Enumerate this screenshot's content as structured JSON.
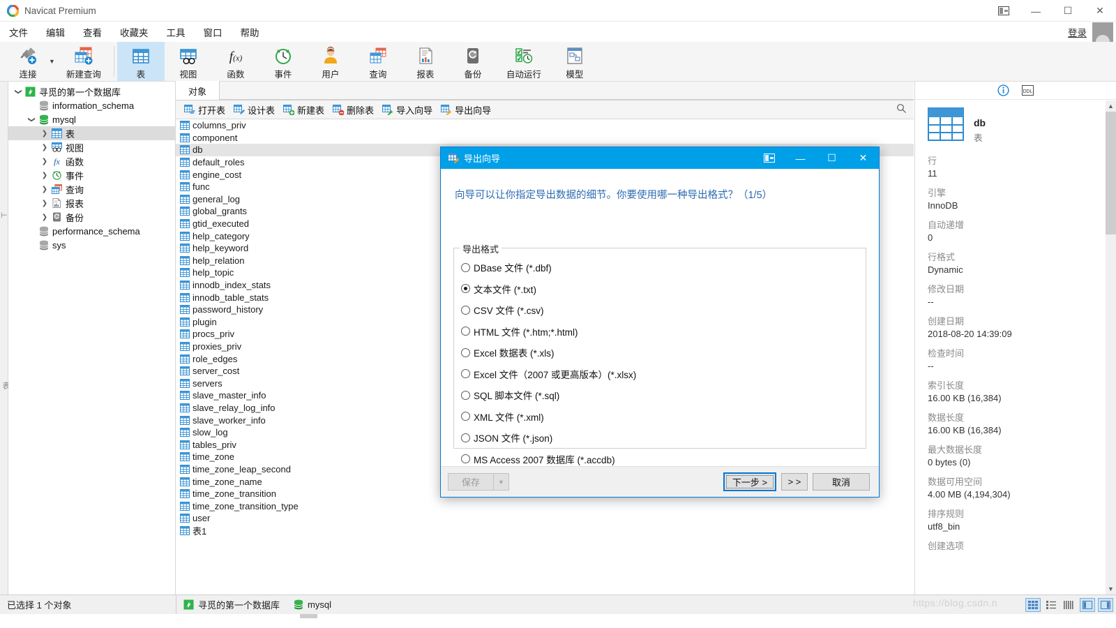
{
  "window": {
    "title": "Navicat Premium",
    "controls": {
      "panel": "panel-toggle",
      "minimize": "—",
      "maximize": "☐",
      "close": "✕"
    }
  },
  "menubar": {
    "items": [
      {
        "label": "文件",
        "name": "menu-file"
      },
      {
        "label": "编辑",
        "name": "menu-edit"
      },
      {
        "label": "查看",
        "name": "menu-view"
      },
      {
        "label": "收藏夹",
        "name": "menu-favorites"
      },
      {
        "label": "工具",
        "name": "menu-tools"
      },
      {
        "label": "窗口",
        "name": "menu-window"
      },
      {
        "label": "帮助",
        "name": "menu-help"
      }
    ],
    "login_label": "登录"
  },
  "ribbon": {
    "items": [
      {
        "label": "连接",
        "icon": "connection-icon",
        "active": false
      },
      {
        "label": "新建查询",
        "icon": "new-query-icon",
        "active": false
      },
      {
        "label": "表",
        "icon": "table-icon",
        "active": true
      },
      {
        "label": "视图",
        "icon": "view-icon",
        "active": false
      },
      {
        "label": "函数",
        "icon": "function-icon",
        "active": false
      },
      {
        "label": "事件",
        "icon": "event-icon",
        "active": false
      },
      {
        "label": "用户",
        "icon": "user-icon",
        "active": false
      },
      {
        "label": "查询",
        "icon": "query-icon",
        "active": false
      },
      {
        "label": "报表",
        "icon": "report-icon",
        "active": false
      },
      {
        "label": "备份",
        "icon": "backup-icon",
        "active": false
      },
      {
        "label": "自动运行",
        "icon": "automation-icon",
        "active": false
      },
      {
        "label": "模型",
        "icon": "model-icon",
        "active": false
      }
    ]
  },
  "tree": {
    "nodes": [
      {
        "label": "寻觅的第一个数据库",
        "indent": 0,
        "twisty": "down",
        "icon": "navicat-connection-icon",
        "selected": false
      },
      {
        "label": "information_schema",
        "indent": 1,
        "twisty": "",
        "icon": "database-icon",
        "selected": false
      },
      {
        "label": "mysql",
        "indent": 1,
        "twisty": "down",
        "icon": "database-open-icon",
        "selected": false
      },
      {
        "label": "表",
        "indent": 2,
        "twisty": "right",
        "icon": "table-icon",
        "selected": true
      },
      {
        "label": "视图",
        "indent": 2,
        "twisty": "right",
        "icon": "view-icon",
        "selected": false
      },
      {
        "label": "函数",
        "indent": 2,
        "twisty": "right",
        "icon": "function-icon",
        "selected": false
      },
      {
        "label": "事件",
        "indent": 2,
        "twisty": "right",
        "icon": "event-icon",
        "selected": false
      },
      {
        "label": "查询",
        "indent": 2,
        "twisty": "right",
        "icon": "query-icon",
        "selected": false
      },
      {
        "label": "报表",
        "indent": 2,
        "twisty": "right",
        "icon": "report-icon",
        "selected": false
      },
      {
        "label": "备份",
        "indent": 2,
        "twisty": "right",
        "icon": "backup-icon",
        "selected": false
      },
      {
        "label": "performance_schema",
        "indent": 1,
        "twisty": "",
        "icon": "database-icon",
        "selected": false
      },
      {
        "label": "sys",
        "indent": 1,
        "twisty": "",
        "icon": "database-icon",
        "selected": false
      }
    ]
  },
  "center": {
    "tab_label": "对象",
    "object_toolbar": [
      {
        "label": "打开表",
        "icon": "open-table-icon"
      },
      {
        "label": "设计表",
        "icon": "design-table-icon"
      },
      {
        "label": "新建表",
        "icon": "new-table-icon"
      },
      {
        "label": "删除表",
        "icon": "delete-table-icon"
      },
      {
        "label": "导入向导",
        "icon": "import-wizard-icon"
      },
      {
        "label": "导出向导",
        "icon": "export-wizard-icon"
      }
    ],
    "tables": [
      {
        "name": "columns_priv",
        "selected": false
      },
      {
        "name": "component",
        "selected": false
      },
      {
        "name": "db",
        "selected": true
      },
      {
        "name": "default_roles",
        "selected": false
      },
      {
        "name": "engine_cost",
        "selected": false
      },
      {
        "name": "func",
        "selected": false
      },
      {
        "name": "general_log",
        "selected": false
      },
      {
        "name": "global_grants",
        "selected": false
      },
      {
        "name": "gtid_executed",
        "selected": false
      },
      {
        "name": "help_category",
        "selected": false
      },
      {
        "name": "help_keyword",
        "selected": false
      },
      {
        "name": "help_relation",
        "selected": false
      },
      {
        "name": "help_topic",
        "selected": false
      },
      {
        "name": "innodb_index_stats",
        "selected": false
      },
      {
        "name": "innodb_table_stats",
        "selected": false
      },
      {
        "name": "password_history",
        "selected": false
      },
      {
        "name": "plugin",
        "selected": false
      },
      {
        "name": "procs_priv",
        "selected": false
      },
      {
        "name": "proxies_priv",
        "selected": false
      },
      {
        "name": "role_edges",
        "selected": false
      },
      {
        "name": "server_cost",
        "selected": false
      },
      {
        "name": "servers",
        "selected": false
      },
      {
        "name": "slave_master_info",
        "selected": false
      },
      {
        "name": "slave_relay_log_info",
        "selected": false
      },
      {
        "name": "slave_worker_info",
        "selected": false
      },
      {
        "name": "slow_log",
        "selected": false
      },
      {
        "name": "tables_priv",
        "selected": false
      },
      {
        "name": "time_zone",
        "selected": false
      },
      {
        "name": "time_zone_leap_second",
        "selected": false
      },
      {
        "name": "time_zone_name",
        "selected": false
      },
      {
        "name": "time_zone_transition",
        "selected": false
      },
      {
        "name": "time_zone_transition_type",
        "selected": false
      },
      {
        "name": "user",
        "selected": false
      },
      {
        "name": "表1",
        "selected": false
      }
    ]
  },
  "info_panel": {
    "tabs": [
      {
        "name": "info-tab",
        "label": "i"
      },
      {
        "name": "ddl-tab",
        "label": "DDL"
      }
    ],
    "object_name": "db",
    "object_type": "表",
    "fields": [
      {
        "key": "行",
        "value": "11"
      },
      {
        "key": "引擎",
        "value": "InnoDB"
      },
      {
        "key": "自动递增",
        "value": "0"
      },
      {
        "key": "行格式",
        "value": "Dynamic"
      },
      {
        "key": "修改日期",
        "value": "--"
      },
      {
        "key": "创建日期",
        "value": "2018-08-20 14:39:09"
      },
      {
        "key": "检查时间",
        "value": "--"
      },
      {
        "key": "索引长度",
        "value": "16.00 KB (16,384)"
      },
      {
        "key": "数据长度",
        "value": "16.00 KB (16,384)"
      },
      {
        "key": "最大数据长度",
        "value": "0 bytes (0)"
      },
      {
        "key": "数据可用空间",
        "value": "4.00 MB (4,194,304)"
      },
      {
        "key": "排序规则",
        "value": "utf8_bin"
      },
      {
        "key": "创建选项",
        "value": ""
      }
    ]
  },
  "statusbar": {
    "selection": "已选择 1 个对象",
    "connection": "寻觅的第一个数据库",
    "database": "mysql",
    "watermark": "https://blog.csdn.n",
    "view_buttons": [
      {
        "name": "grid-view-button",
        "active": true
      },
      {
        "name": "list-view-button",
        "active": false
      },
      {
        "name": "detail-view-button",
        "active": false
      },
      {
        "name": "info-pane-button",
        "active": true
      },
      {
        "name": "right-pane-button",
        "active": true
      }
    ]
  },
  "dialog": {
    "title": "导出向导",
    "prompt": "向导可以让你指定导出数据的细节。你要使用哪一种导出格式？（1/5）",
    "group_label": "导出格式",
    "options": [
      {
        "label": "DBase 文件 (*.dbf)",
        "selected": false
      },
      {
        "label": "文本文件 (*.txt)",
        "selected": true
      },
      {
        "label": "CSV 文件 (*.csv)",
        "selected": false
      },
      {
        "label": "HTML 文件 (*.htm;*.html)",
        "selected": false
      },
      {
        "label": "Excel 数据表 (*.xls)",
        "selected": false
      },
      {
        "label": "Excel 文件（2007 或更高版本）(*.xlsx)",
        "selected": false
      },
      {
        "label": "SQL 脚本文件 (*.sql)",
        "selected": false
      },
      {
        "label": "XML 文件 (*.xml)",
        "selected": false
      },
      {
        "label": "JSON 文件 (*.json)",
        "selected": false
      },
      {
        "label": "MS Access 2007 数据库 (*.accdb)",
        "selected": false
      }
    ],
    "buttons": {
      "save": "保存",
      "next": "下一步 >",
      "skip": "> >",
      "cancel": "取消"
    },
    "controls": {
      "panel": "panel-toggle",
      "minimize": "—",
      "maximize": "☐",
      "close": "✕"
    }
  },
  "colors": {
    "accent": "#00a0e9",
    "ribbon_active": "#cce4f7",
    "dialog_prompt": "#2b6bb0",
    "table_blue": "#2e8bd0"
  }
}
